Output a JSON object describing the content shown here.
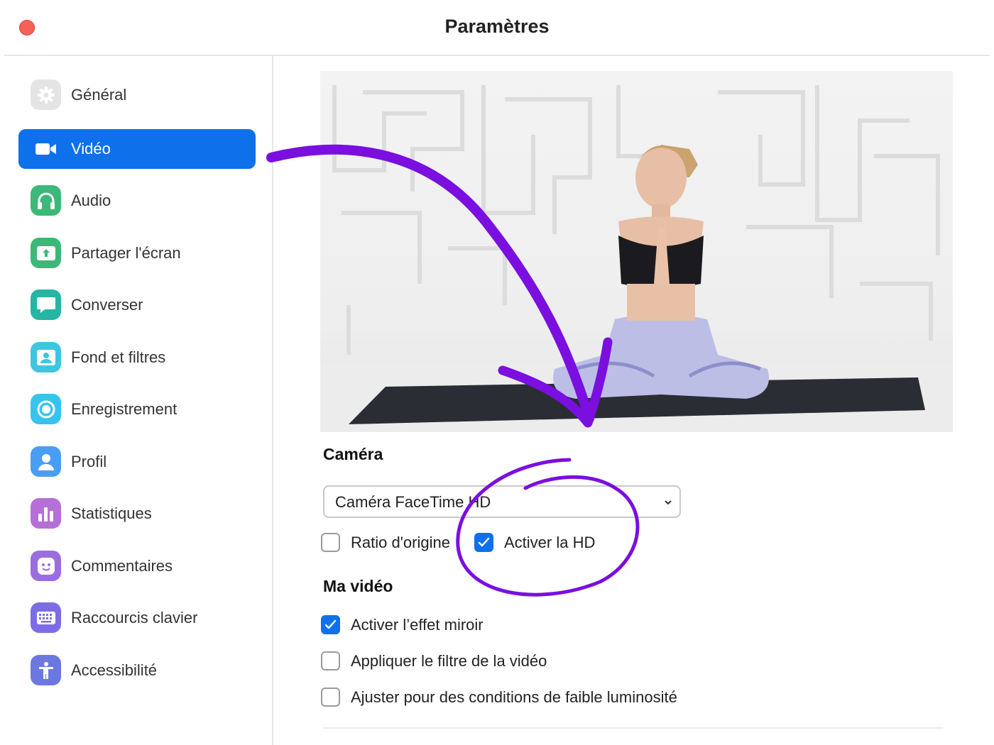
{
  "window": {
    "title": "Paramètres"
  },
  "sidebar": {
    "items": [
      {
        "label": "Général",
        "icon": "gear-icon",
        "color": "#e4e4e4"
      },
      {
        "label": "Vidéo",
        "icon": "video-camera-icon",
        "color": "#0e71eb",
        "active": true
      },
      {
        "label": "Audio",
        "icon": "headphones-icon",
        "color": "#3cb878"
      },
      {
        "label": "Partager l'écran",
        "icon": "share-screen-icon",
        "color": "#3cb878"
      },
      {
        "label": "Converser",
        "icon": "chat-bubble-icon",
        "color": "#26b5a4"
      },
      {
        "label": "Fond et filtres",
        "icon": "portrait-icon",
        "color": "#3ec6e0"
      },
      {
        "label": "Enregistrement",
        "icon": "record-icon",
        "color": "#36c3ee"
      },
      {
        "label": "Profil",
        "icon": "user-icon",
        "color": "#4a9df5"
      },
      {
        "label": "Statistiques",
        "icon": "bar-chart-icon",
        "color": "#b66fd6"
      },
      {
        "label": "Commentaires",
        "icon": "smiley-icon",
        "color": "#9a6de0"
      },
      {
        "label": "Raccourcis clavier",
        "icon": "keyboard-icon",
        "color": "#7b6ee4"
      },
      {
        "label": "Accessibilité",
        "icon": "accessibility-icon",
        "color": "#6b78e0"
      }
    ]
  },
  "camera": {
    "section_title": "Caméra",
    "select_value": "Caméra FaceTime HD",
    "options": [
      {
        "label": "Ratio d'origine",
        "checked": false
      },
      {
        "label": "Activer la HD",
        "checked": true
      }
    ]
  },
  "my_video": {
    "section_title": "Ma vidéo",
    "options": [
      {
        "label": "Activer l’effet miroir",
        "checked": true
      },
      {
        "label": "Appliquer le filtre de la vidéo",
        "checked": false
      },
      {
        "label": "Ajuster pour des conditions de faible luminosité",
        "checked": false
      }
    ]
  },
  "colors": {
    "accent": "#0e71eb",
    "annotation": "#7a0fe0",
    "close_button": "#f4625a"
  }
}
